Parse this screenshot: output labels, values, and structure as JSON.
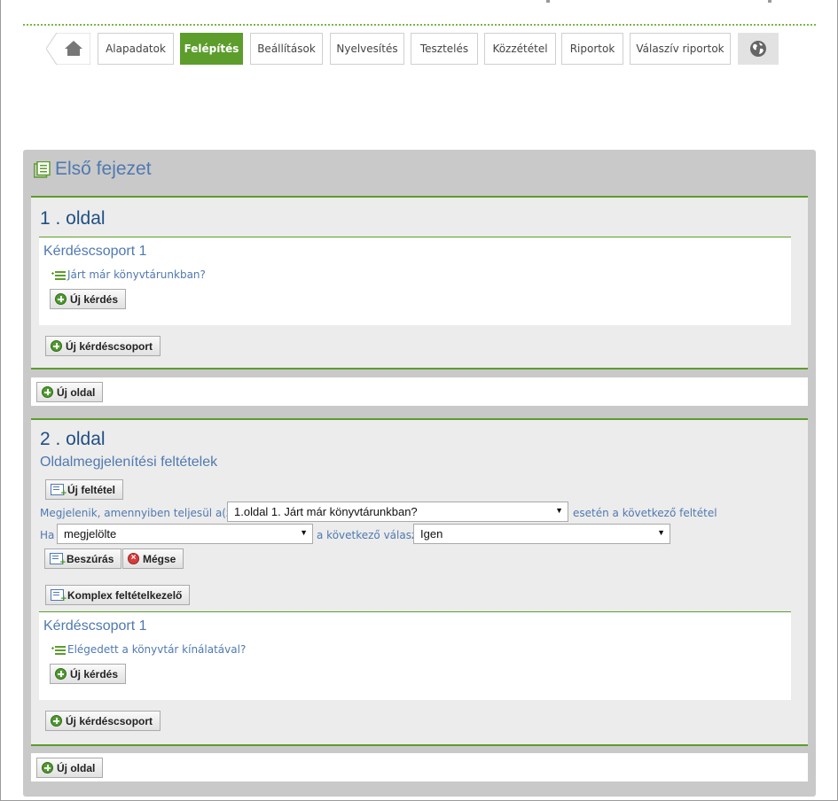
{
  "nav": {
    "tabs": [
      {
        "label": "Alapadatok",
        "active": false
      },
      {
        "label": "Felépítés",
        "active": true
      },
      {
        "label": "Beállítások",
        "active": false
      },
      {
        "label": "Nyelvesítés",
        "active": false
      },
      {
        "label": "Tesztelés",
        "active": false
      },
      {
        "label": "Közzététel",
        "active": false
      },
      {
        "label": "Riportok",
        "active": false
      },
      {
        "label": "Válaszív riportok",
        "active": false
      }
    ],
    "home_icon": "home-icon",
    "globe_icon": "globe-icon"
  },
  "colors": {
    "accent": "#5c9d2c",
    "link": "#4f79b0",
    "panel": "#c9c9c9"
  },
  "chapter": {
    "title": "Első fejezet",
    "pages": [
      {
        "title": "1 . oldal",
        "group": {
          "title": "Kérdéscsoport 1",
          "question": "Járt már könyvtárunkban?",
          "new_question": "Új kérdés"
        },
        "new_group": "Új kérdéscsoport"
      },
      {
        "title": "2 . oldal",
        "conditions_title": "Oldalmegjelenítési feltételek",
        "new_condition": "Új feltétel",
        "condition_prefix": "Megjelenik, amennyiben teljesül a(z)",
        "condition_question_select": "1.oldal 1. Járt már könyvtárunkban?",
        "condition_suffix": "esetén a következő feltétel",
        "if_label": "Ha",
        "state_select": "megjelölte",
        "answer_label": "a következő válasz",
        "answer_select": "Igen",
        "insert": "Beszúrás",
        "cancel": "Mégse",
        "complex": "Komplex feltételkezelő",
        "group": {
          "title": "Kérdéscsoport 1",
          "question": "Elégedett a könyvtár kínálatával?",
          "new_question": "Új kérdés"
        },
        "new_group": "Új kérdéscsoport"
      }
    ],
    "new_page": "Új oldal"
  }
}
